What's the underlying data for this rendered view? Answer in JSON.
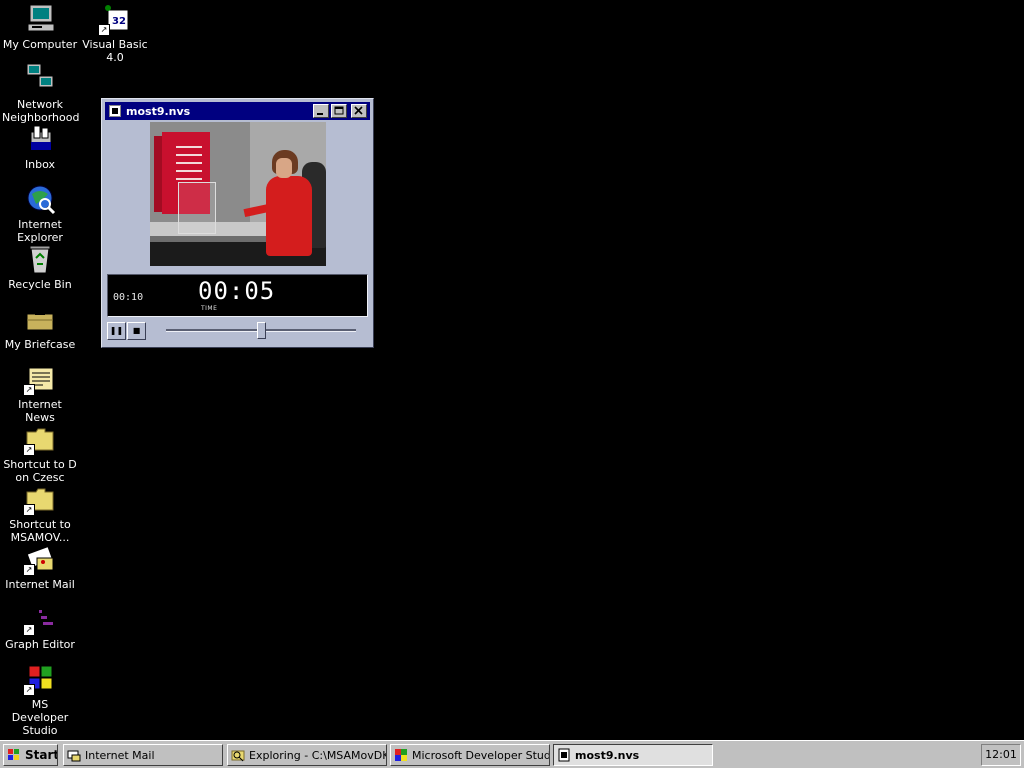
{
  "desktop": {
    "icons": [
      {
        "label": "My Computer",
        "icon": "my-computer-icon"
      },
      {
        "label": "Visual Basic\n4.0",
        "icon": "visual-basic-icon"
      },
      {
        "label": "Network\nNeighborhood",
        "icon": "network-neighborhood-icon"
      },
      {
        "label": "Inbox",
        "icon": "inbox-icon"
      },
      {
        "label": "Internet\nExplorer",
        "icon": "internet-explorer-icon"
      },
      {
        "label": "Recycle Bin",
        "icon": "recycle-bin-icon"
      },
      {
        "label": "My Briefcase",
        "icon": "briefcase-icon"
      },
      {
        "label": "Internet News",
        "icon": "internet-news-icon"
      },
      {
        "label": "Shortcut to D\non Czesc",
        "icon": "folder-shortcut-icon"
      },
      {
        "label": "Shortcut to\nMSAMOV...",
        "icon": "folder-shortcut-icon"
      },
      {
        "label": "Internet Mail",
        "icon": "internet-mail-icon"
      },
      {
        "label": "Graph Editor",
        "icon": "graph-editor-icon"
      },
      {
        "label": "MS Developer\nStudio",
        "icon": "ms-developer-studio-icon"
      }
    ]
  },
  "media_window": {
    "title": "most9.nvs",
    "total_time": "00:10",
    "current_time": "00:05",
    "time_label": "TIME",
    "position_fraction": 0.5,
    "pause_glyph": "❚❚",
    "stop_glyph": "■"
  },
  "taskbar": {
    "start_label": "Start",
    "tasks": [
      {
        "label": "Internet Mail",
        "icon": "internet-mail-icon"
      },
      {
        "label": "Exploring - C:\\MSAMovDK...",
        "icon": "explorer-icon"
      },
      {
        "label": "Microsoft Developer Studi...",
        "icon": "ms-developer-studio-icon"
      },
      {
        "label": "most9.nvs",
        "icon": "media-file-icon"
      }
    ],
    "clock": "12:01"
  },
  "colors": {
    "desktop": "#000000",
    "titlebar": "#000080",
    "window_face": "#b6bdd2",
    "taskbar": "#c0c0c0"
  }
}
